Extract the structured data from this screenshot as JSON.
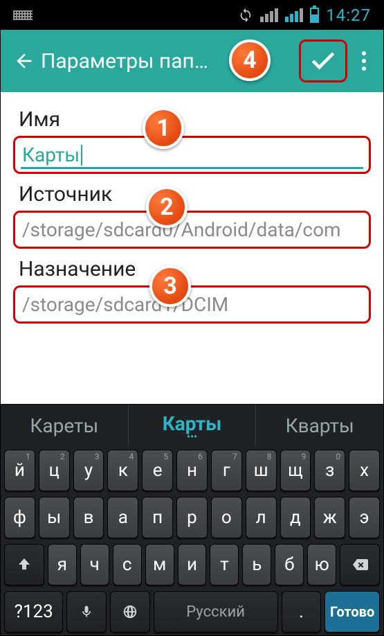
{
  "status": {
    "time": "14:27"
  },
  "appbar": {
    "title": "Параметры пап…"
  },
  "annotations": {
    "b1": "1",
    "b2": "2",
    "b3": "3",
    "b4": "4"
  },
  "form": {
    "name_label": "Имя",
    "name_value": "Карты",
    "source_label": "Источник",
    "source_value": "/storage/sdcard0/Android/data/com",
    "dest_label": "Назначение",
    "dest_value": "/storage/sdcard1/DCIM"
  },
  "keyboard": {
    "suggestions": [
      "Кареты",
      "Карты",
      "Кварты"
    ],
    "row1": [
      {
        "k": "й",
        "h": "1"
      },
      {
        "k": "ц",
        "h": "2"
      },
      {
        "k": "у",
        "h": "3"
      },
      {
        "k": "к",
        "h": "4"
      },
      {
        "k": "е",
        "h": "5"
      },
      {
        "k": "н",
        "h": "6"
      },
      {
        "k": "г",
        "h": "7"
      },
      {
        "k": "ш",
        "h": "8"
      },
      {
        "k": "щ",
        "h": "9"
      },
      {
        "k": "з",
        "h": "0"
      },
      {
        "k": "х",
        "h": ""
      }
    ],
    "row2": [
      {
        "k": "ф"
      },
      {
        "k": "ы"
      },
      {
        "k": "в"
      },
      {
        "k": "а"
      },
      {
        "k": "п"
      },
      {
        "k": "р"
      },
      {
        "k": "о"
      },
      {
        "k": "л"
      },
      {
        "k": "д"
      },
      {
        "k": "ж"
      },
      {
        "k": "э"
      }
    ],
    "row3": [
      {
        "k": "я"
      },
      {
        "k": "ч"
      },
      {
        "k": "с"
      },
      {
        "k": "м"
      },
      {
        "k": "и"
      },
      {
        "k": "т"
      },
      {
        "k": "ь"
      },
      {
        "k": "б"
      },
      {
        "k": "ю"
      }
    ],
    "sym_key": "?123",
    "space_label": "Русский",
    "period_key": ".",
    "done_label": "Готово"
  }
}
